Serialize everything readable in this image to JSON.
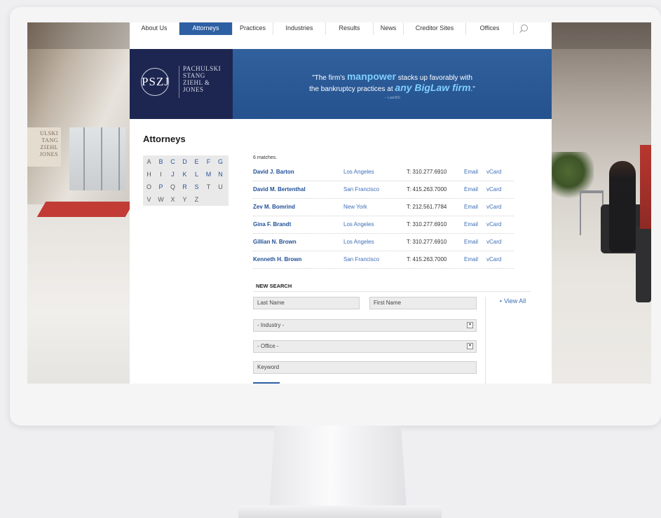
{
  "nav": {
    "items": [
      "About Us",
      "Attorneys",
      "Practices",
      "Industries",
      "Results",
      "News",
      "Creditor Sites",
      "Offices"
    ],
    "active": "Attorneys",
    "search_icon": "search-icon"
  },
  "logo": {
    "mark": "PSZJ",
    "names": [
      "PACHULSKI",
      "STANG",
      "ZIEHL &",
      "JONES"
    ]
  },
  "banner": {
    "quote_open": "\"The firm's ",
    "quote_highlight": "manpower",
    "quote_mid": " stacks up favorably with",
    "quote_line2_start": "the bankruptcy practices at ",
    "quote_highlight2": "any BigLaw firm",
    "quote_end": ".\"",
    "attribution": "-- Law360"
  },
  "background": {
    "sign_lines": [
      "ULSKI",
      "TANG",
      "ZIEHL",
      "JONES"
    ]
  },
  "page": {
    "title": "Attorneys",
    "matches": "6 matches."
  },
  "alphabet": {
    "letters": [
      "A",
      "B",
      "C",
      "D",
      "E",
      "F",
      "G",
      "H",
      "I",
      "J",
      "K",
      "L",
      "M",
      "N",
      "O",
      "P",
      "Q",
      "R",
      "S",
      "T",
      "U",
      "V",
      "W",
      "X",
      "Y",
      "Z"
    ],
    "inactive": [
      "A",
      "H",
      "I",
      "O",
      "Q",
      "T",
      "U",
      "V",
      "W",
      "X",
      "Y",
      "Z"
    ]
  },
  "results": [
    {
      "name": "David J. Barton",
      "city": "Los Angeles",
      "phone": "T: 310.277.6910",
      "email": "Email",
      "vcard": "vCard"
    },
    {
      "name": "David M. Bertenthal",
      "city": "San Francisco",
      "phone": "T: 415.263.7000",
      "email": "Email",
      "vcard": "vCard"
    },
    {
      "name": "Zev M. Bomrind",
      "city": "New York",
      "phone": "T: 212.561.7784",
      "email": "Email",
      "vcard": "vCard"
    },
    {
      "name": "Gina F. Brandt",
      "city": "Los Angeles",
      "phone": "T: 310.277.6910",
      "email": "Email",
      "vcard": "vCard"
    },
    {
      "name": "Gillian N. Brown",
      "city": "Los Angeles",
      "phone": "T: 310.277.6910",
      "email": "Email",
      "vcard": "vCard"
    },
    {
      "name": "Kenneth H. Brown",
      "city": "San Francisco",
      "phone": "T: 415.263.7000",
      "email": "Email",
      "vcard": "vCard"
    }
  ],
  "search": {
    "title": "NEW SEARCH",
    "last_name_placeholder": "Last Name",
    "first_name_placeholder": "First Name",
    "industry_value": "- Industry -",
    "office_value": "- Office -",
    "keyword_placeholder": "Keyword",
    "view_all": "View All"
  },
  "colors": {
    "nav_active": "#2d5fa3",
    "logo_bg": "#1d2650",
    "banner_bg": "#2a5896",
    "link": "#3e6fb6",
    "name_link": "#1f4e96",
    "highlight": "#7fd0ff"
  }
}
